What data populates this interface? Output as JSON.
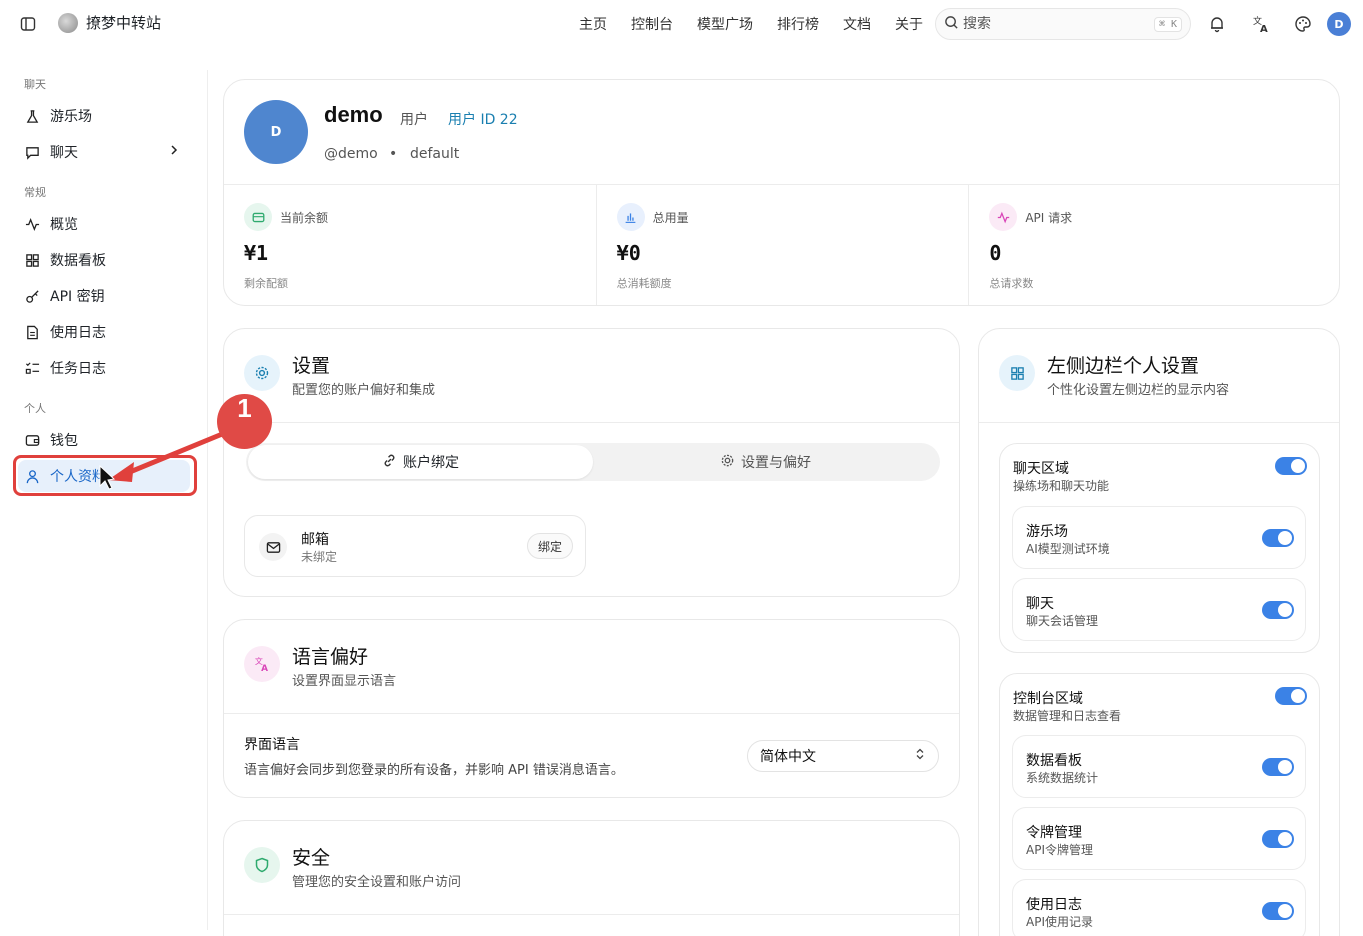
{
  "brand": {
    "name": "撩梦中转站"
  },
  "nav": [
    "主页",
    "控制台",
    "模型广场",
    "排行榜",
    "文档",
    "关于"
  ],
  "search": {
    "placeholder": "搜索",
    "shortcut": "⌘ K"
  },
  "user_avatar_letter": "D",
  "sidebar": {
    "sections": [
      {
        "title": "聊天",
        "items": [
          {
            "label": "游乐场",
            "icon": "flask-icon"
          },
          {
            "label": "聊天",
            "icon": "message-icon",
            "has_chevron": true
          }
        ]
      },
      {
        "title": "常规",
        "items": [
          {
            "label": "概览",
            "icon": "activity-icon"
          },
          {
            "label": "数据看板",
            "icon": "grid-icon"
          },
          {
            "label": "API 密钥",
            "icon": "key-icon"
          },
          {
            "label": "使用日志",
            "icon": "file-icon"
          },
          {
            "label": "任务日志",
            "icon": "list-check-icon"
          }
        ]
      },
      {
        "title": "个人",
        "items": [
          {
            "label": "钱包",
            "icon": "wallet-icon"
          },
          {
            "label": "个人资料",
            "icon": "user-icon",
            "active": true
          }
        ]
      }
    ]
  },
  "profile": {
    "avatar_letter": "D",
    "name": "demo",
    "role": "用户",
    "uid": "用户 ID 22",
    "handle": "@demo",
    "dot": "•",
    "group": "default"
  },
  "stats": [
    {
      "label": "当前余额",
      "value": "¥1",
      "sub": "剩余配额",
      "icon": "wallet-icon",
      "color": "#2eaa6e"
    },
    {
      "label": "总用量",
      "value": "¥0",
      "sub": "总消耗额度",
      "icon": "bar-chart-icon",
      "color": "#3b82e6"
    },
    {
      "label": "API 请求",
      "value": "0",
      "sub": "总请求数",
      "icon": "activity-icon",
      "color": "#d946b8"
    }
  ],
  "settings": {
    "title": "设置",
    "subtitle": "配置您的账户偏好和集成",
    "tabs": [
      {
        "label": "账户绑定",
        "active": true
      },
      {
        "label": "设置与偏好",
        "active": false
      }
    ],
    "binding": {
      "title": "邮箱",
      "status": "未绑定",
      "button": "绑定"
    }
  },
  "language": {
    "title": "语言偏好",
    "subtitle": "设置界面显示语言",
    "label": "界面语言",
    "description": "语言偏好会同步到您登录的所有设备，并影响 API 错误消息语言。",
    "selected": "简体中文"
  },
  "security": {
    "title": "安全",
    "subtitle": "管理您的安全设置和账户访问"
  },
  "sidebar_settings": {
    "title": "左侧边栏个人设置",
    "subtitle": "个性化设置左侧边栏的显示内容",
    "groups": [
      {
        "title": "聊天区域",
        "subtitle": "操练场和聊天功能",
        "enabled": true,
        "items": [
          {
            "title": "游乐场",
            "subtitle": "AI模型测试环境",
            "enabled": true
          },
          {
            "title": "聊天",
            "subtitle": "聊天会话管理",
            "enabled": true
          }
        ]
      },
      {
        "title": "控制台区域",
        "subtitle": "数据管理和日志查看",
        "enabled": true,
        "items": [
          {
            "title": "数据看板",
            "subtitle": "系统数据统计",
            "enabled": true
          },
          {
            "title": "令牌管理",
            "subtitle": "API令牌管理",
            "enabled": true
          },
          {
            "title": "使用日志",
            "subtitle": "API使用记录",
            "enabled": true
          }
        ]
      }
    ]
  },
  "annotation": {
    "number": "1",
    "color": "#e0403c"
  }
}
